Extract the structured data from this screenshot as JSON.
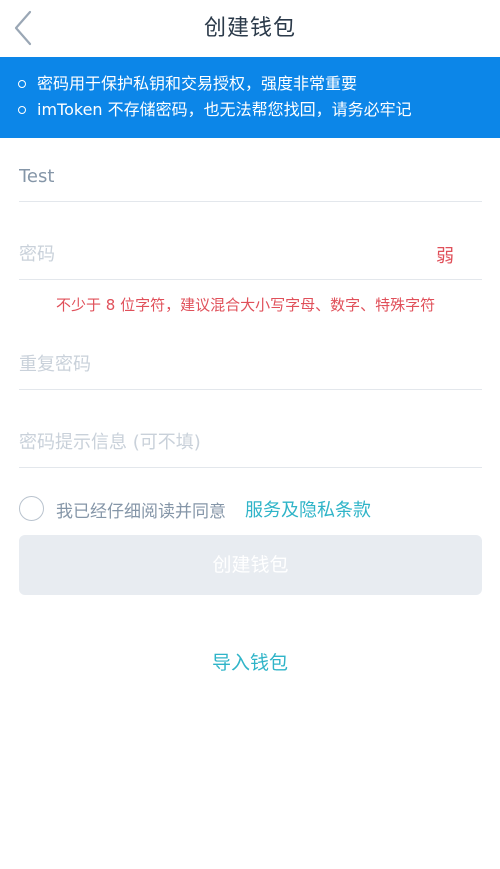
{
  "nav": {
    "title": "创建钱包",
    "back_icon": "chevron-left-icon"
  },
  "notice": {
    "background_color": "#0c86e8",
    "items": [
      "密码用于保护私钥和交易授权，强度非常重要",
      "imToken 不存储密码，也无法帮您找回，请务必牢记"
    ]
  },
  "form": {
    "wallet_name": {
      "value": "Test",
      "placeholder": ""
    },
    "password": {
      "value": "",
      "placeholder": "密码",
      "strength": "弱"
    },
    "password_hint": "不少于 8 位字符，建议混合大小写字母、数字、特殊字符",
    "repeat_password": {
      "value": "",
      "placeholder": "重复密码"
    },
    "password_tip": {
      "value": "",
      "placeholder": "密码提示信息 (可不填)"
    }
  },
  "agreement": {
    "checked": false,
    "text": "我已经仔细阅读并同意",
    "link": "服务及隐私条款"
  },
  "actions": {
    "create_label": "创建钱包",
    "import_label": "导入钱包"
  },
  "colors": {
    "accent": "#2fb4c8",
    "warning": "#e0505a",
    "disabled_button": "#e8ecf1"
  }
}
